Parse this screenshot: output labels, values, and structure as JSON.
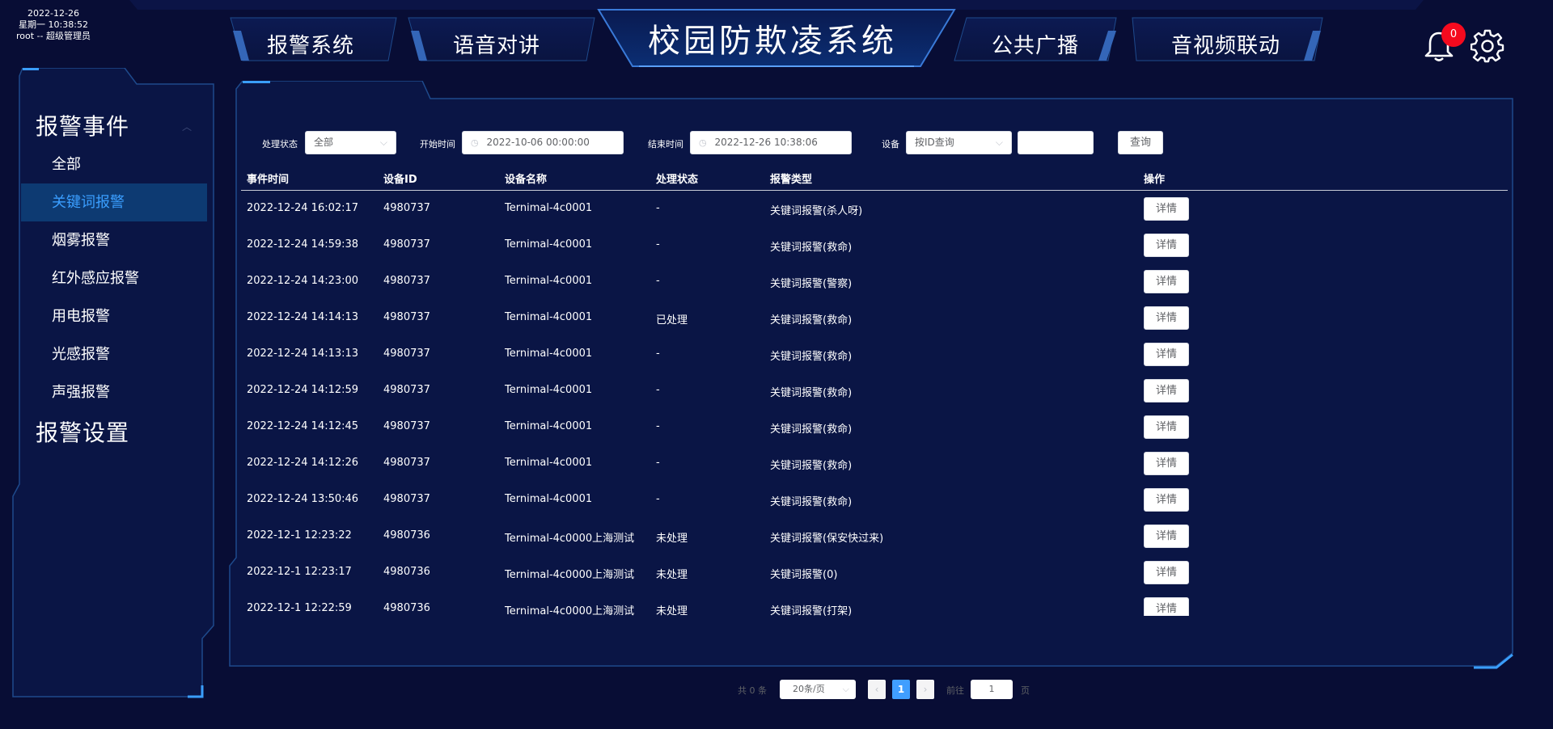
{
  "sysinfo": {
    "date": "2022-12-26",
    "weekday_time": "星期一 10:38:52",
    "user": "root -- 超级管理员"
  },
  "nav": {
    "tabs": [
      "报警系统",
      "语音对讲",
      "公共广播",
      "音视频联动"
    ],
    "title": "校园防欺凌系统",
    "notification_count": "0"
  },
  "sidebar": {
    "group1": "报警事件",
    "items": [
      "全部",
      "关键词报警",
      "烟雾报警",
      "红外感应报警",
      "用电报警",
      "光感报警",
      "声强报警"
    ],
    "active_index": 1,
    "group2": "报警设置"
  },
  "filters": {
    "status_label": "处理状态",
    "status_value": "全部",
    "start_label": "开始时间",
    "start_value": "2022-10-06 00:00:00",
    "end_label": "结束时间",
    "end_value": "2022-12-26 10:38:06",
    "device_label": "设备",
    "device_mode": "按ID查询",
    "device_value": "",
    "query_button": "查询"
  },
  "table": {
    "columns": [
      "事件时间",
      "设备ID",
      "设备名称",
      "处理状态",
      "报警类型",
      "操作"
    ],
    "action_label": "详情",
    "rows": [
      [
        "2022-12-24 16:02:17",
        "4980737",
        "Ternimal-4c0001",
        "-",
        "关键词报警(杀人呀)"
      ],
      [
        "2022-12-24 14:59:38",
        "4980737",
        "Ternimal-4c0001",
        "-",
        "关键词报警(救命)"
      ],
      [
        "2022-12-24 14:23:00",
        "4980737",
        "Ternimal-4c0001",
        "-",
        "关键词报警(警察)"
      ],
      [
        "2022-12-24 14:14:13",
        "4980737",
        "Ternimal-4c0001",
        "已处理",
        "关键词报警(救命)"
      ],
      [
        "2022-12-24 14:13:13",
        "4980737",
        "Ternimal-4c0001",
        "-",
        "关键词报警(救命)"
      ],
      [
        "2022-12-24 14:12:59",
        "4980737",
        "Ternimal-4c0001",
        "-",
        "关键词报警(救命)"
      ],
      [
        "2022-12-24 14:12:45",
        "4980737",
        "Ternimal-4c0001",
        "-",
        "关键词报警(救命)"
      ],
      [
        "2022-12-24 14:12:26",
        "4980737",
        "Ternimal-4c0001",
        "-",
        "关键词报警(救命)"
      ],
      [
        "2022-12-24 13:50:46",
        "4980737",
        "Ternimal-4c0001",
        "-",
        "关键词报警(救命)"
      ],
      [
        "2022-12-1 12:23:22",
        "4980736",
        "Ternimal-4c0000上海测试",
        "未处理",
        "关键词报警(保安快过来)"
      ],
      [
        "2022-12-1 12:23:17",
        "4980736",
        "Ternimal-4c0000上海测试",
        "未处理",
        "关键词报警(0)"
      ],
      [
        "2022-12-1 12:22:59",
        "4980736",
        "Ternimal-4c0000上海测试",
        "未处理",
        "关键词报警(打架)"
      ]
    ]
  },
  "pagination": {
    "total": "共 0 条",
    "page_size": "20条/页",
    "current_page": "1",
    "goto_label": "前往",
    "goto_value": "1",
    "page_suffix": "页"
  },
  "colors": {
    "background": "#080d35",
    "panel": "#0a1545",
    "border": "#1e4a8c",
    "accent": "#3a9eff",
    "active_bg": "#0d3a72",
    "badge": "#f50a1e"
  }
}
